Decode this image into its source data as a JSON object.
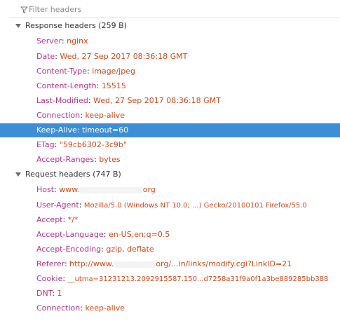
{
  "filter": {
    "placeholder": "Filter headers",
    "icon": "funnel-icon"
  },
  "response": {
    "title": "Response headers (259 B)",
    "headers": [
      {
        "name": "Server",
        "value": "nginx"
      },
      {
        "name": "Date",
        "value": "Wed, 27 Sep 2017 08:36:18 GMT"
      },
      {
        "name": "Content-Type",
        "value": "image/jpeg"
      },
      {
        "name": "Content-Length",
        "value": "15515"
      },
      {
        "name": "Last-Modified",
        "value": "Wed, 27 Sep 2017 08:36:18 GMT"
      },
      {
        "name": "Connection",
        "value": "keep-alive"
      },
      {
        "name": "Keep-Alive",
        "value": "timeout=60"
      },
      {
        "name": "ETag",
        "value": "\"59cb6302-3c9b\""
      },
      {
        "name": "Accept-Ranges",
        "value": "bytes"
      }
    ]
  },
  "request": {
    "title": "Request headers (747 B)",
    "headers": [
      {
        "name": "Host",
        "value_a": "www.",
        "value_b": "org"
      },
      {
        "name": "User-Agent",
        "value": "Mozilla/5.0 (Windows NT 10.0; ...) Gecko/20100101 Firefox/55.0"
      },
      {
        "name": "Accept",
        "value": "*/*"
      },
      {
        "name": "Accept-Language",
        "value": "en-US,en;q=0.5"
      },
      {
        "name": "Accept-Encoding",
        "value": "gzip, deflate"
      },
      {
        "name": "Referer",
        "value_a": "http://www.",
        "value_b": "org/...in/links/modify.cgi?LinkID=21"
      },
      {
        "name": "Cookie",
        "value": "__utma=31231213.2092915587.150...d7258a31f9a0f1a3be889285bb388"
      },
      {
        "name": "DNT",
        "value": "1"
      },
      {
        "name": "Connection",
        "value": "keep-alive"
      }
    ]
  },
  "selection": {
    "section": "response",
    "header": "Keep-Alive",
    "color": "#3d8ed6"
  },
  "colors": {
    "header_name": "#b5328d",
    "header_value": "#d2491a"
  }
}
